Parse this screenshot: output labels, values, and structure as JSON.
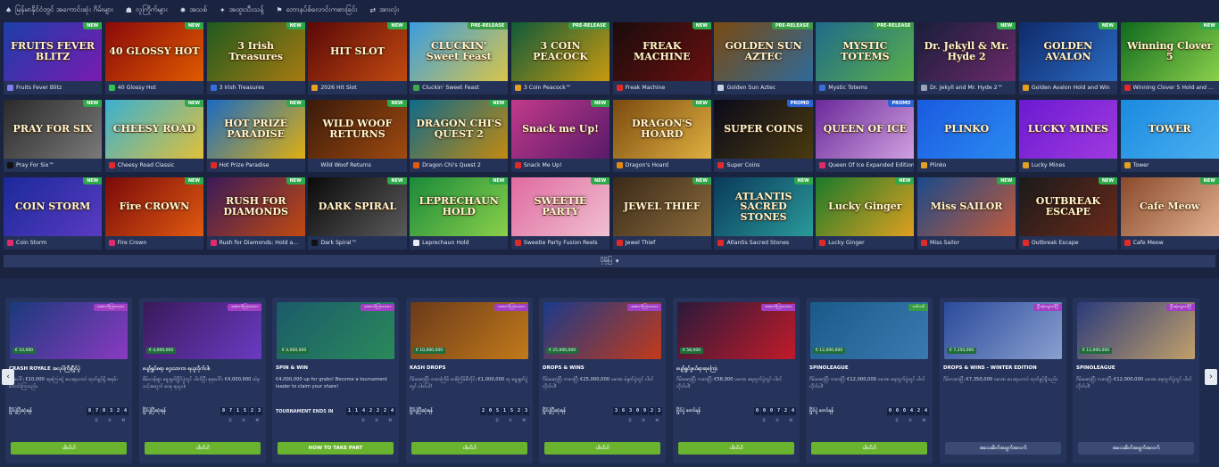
{
  "topnav": [
    {
      "icon": "casino-icon",
      "glyph": "♠",
      "label": "မြန်မာနိုင်ငံတွင် အကောင်းဆုံး ဂိမ်းများ"
    },
    {
      "icon": "lobby-icon",
      "glyph": "☗",
      "label": "လူကြိုက်များ"
    },
    {
      "icon": "new-icon",
      "glyph": "✹",
      "label": "အသစ်"
    },
    {
      "icon": "jackpot-icon",
      "glyph": "✦",
      "label": "အထူးသီးသန့်"
    },
    {
      "icon": "live-icon",
      "glyph": "⚑",
      "label": "ဘောနပ်စ်လောင်းကစားခြင်း"
    },
    {
      "icon": "all-icon",
      "glyph": "⇄",
      "label": "အားလုံး"
    }
  ],
  "games": [
    {
      "thumb": "FRUITS FEVER BLITZ",
      "name": "Fruits Fever Blitz",
      "badge": "NEW",
      "c1": "#1b3fa8",
      "c2": "#7a1bb0",
      "ic": "#7e7ef0"
    },
    {
      "thumb": "40 GLOSSY HOT",
      "name": "40 Glossy Hot",
      "badge": "NEW",
      "c1": "#8a0a0a",
      "c2": "#e05a00",
      "ic": "#33c24f"
    },
    {
      "thumb": "3 Irish Treasures",
      "name": "3 Irish Treasures",
      "badge": "NEW",
      "c1": "#1f5a1f",
      "c2": "#a77a10",
      "ic": "#3a6fd8"
    },
    {
      "thumb": "HIT SLOT",
      "name": "2026 Hit Slot",
      "badge": "NEW",
      "c1": "#5a0808",
      "c2": "#c24a10",
      "ic": "#e8a020"
    },
    {
      "thumb": "CLUCKIN' Sweet Feast",
      "name": "Cluckin' Sweet Feast",
      "badge": "PRE-RELEASE",
      "c1": "#3a9de0",
      "c2": "#d8c44a",
      "ic": "#3fa84a"
    },
    {
      "thumb": "3 COIN PEACOCK",
      "name": "3 Coin Peacock™",
      "badge": "PRE-RELEASE",
      "c1": "#0f5a3a",
      "c2": "#c99a10",
      "ic": "#e0a020"
    },
    {
      "thumb": "FREAK MACHINE",
      "name": "Freak Machine",
      "badge": "NEW",
      "c1": "#1a0c0c",
      "c2": "#6a1010",
      "ic": "#e02a2a"
    },
    {
      "thumb": "GOLDEN SUN AZTEC",
      "name": "Golden Sun Aztec",
      "badge": "PRE-RELEASE",
      "c1": "#7a4a10",
      "c2": "#2f6a9a",
      "ic": "#c7cfe0"
    },
    {
      "thumb": "MYSTIC TOTEMS",
      "name": "Mystic Totems",
      "badge": "PRE-RELEASE",
      "c1": "#1f6a8a",
      "c2": "#5ab04a",
      "ic": "#3a6fd8"
    },
    {
      "thumb": "Dr. Jekyll & Mr. Hyde 2",
      "name": "Dr. Jekyll and Mr. Hyde 2™",
      "badge": "NEW",
      "c1": "#1a1e3a",
      "c2": "#6a2a6a",
      "ic": "#9aa3b8"
    },
    {
      "thumb": "GOLDEN AVALON",
      "name": "Golden Avalon Hold and Win",
      "badge": "NEW",
      "c1": "#0f2a6a",
      "c2": "#2a6ac2",
      "ic": "#e0a020"
    },
    {
      "thumb": "Winning Clover 5",
      "name": "Winning Clover 5 Hold and ...",
      "badge": "NEW",
      "c1": "#0f6a1f",
      "c2": "#8ad04a",
      "ic": "#e02a2a"
    },
    {
      "thumb": "PRAY FOR SIX",
      "name": "Pray For Six™",
      "badge": "NEW",
      "c1": "#2a2a2a",
      "c2": "#7a7a7a",
      "ic": "#111111"
    },
    {
      "thumb": "CHEESY ROAD",
      "name": "Cheesy Road Classic",
      "badge": "NEW",
      "c1": "#3ab0d0",
      "c2": "#e0c03a",
      "ic": "#e02a2a"
    },
    {
      "thumb": "HOT PRIZE PARADISE",
      "name": "Hot Prize Paradise",
      "badge": "NEW",
      "c1": "#1a6ac2",
      "c2": "#e0b010",
      "ic": "#e02a2a"
    },
    {
      "thumb": "WILD WOOF RETURNS",
      "name": "Wild Woof Returns",
      "badge": "NEW",
      "c1": "#3a1a0a",
      "c2": "#a04a10",
      "ic": "#243257"
    },
    {
      "thumb": "DRAGON CHI'S QUEST 2",
      "name": "Dragon Chi's Quest 2",
      "badge": "NEW",
      "c1": "#0f6a8a",
      "c2": "#c28a10",
      "ic": "#e05a10"
    },
    {
      "thumb": "Snack me Up!",
      "name": "Snack Me Up!",
      "badge": "NEW",
      "c1": "#c23a8a",
      "c2": "#5a1a6a",
      "ic": "#e02a2a"
    },
    {
      "thumb": "DRAGON'S HOARD",
      "name": "Dragon's Hoard",
      "badge": "NEW",
      "c1": "#7a4a10",
      "c2": "#e0b040",
      "ic": "#e08a10"
    },
    {
      "thumb": "SUPER COINS",
      "name": "Super Coins",
      "badge": "PROMO",
      "c1": "#0a0a1a",
      "c2": "#4a3a10",
      "ic": "#e02a2a"
    },
    {
      "thumb": "QUEEN OF ICE",
      "name": "Queen Of Ice Expanded Edition",
      "badge": "PROMO",
      "c1": "#6a2a9a",
      "c2": "#d0a0e0",
      "ic": "#e02a6a"
    },
    {
      "thumb": "PLINKO",
      "name": "Plinko",
      "badge": "",
      "c1": "#1a5ae0",
      "c2": "#2a8af0",
      "ic": "#e0a020"
    },
    {
      "thumb": "LUCKY MINES",
      "name": "Lucky Mines",
      "badge": "",
      "c1": "#6a1ad0",
      "c2": "#a03ae0",
      "ic": "#e0a020"
    },
    {
      "thumb": "TOWER",
      "name": "Tower",
      "badge": "",
      "c1": "#1a8ae0",
      "c2": "#4ab0f0",
      "ic": "#e0a020"
    },
    {
      "thumb": "COIN STORM",
      "name": "Coin Storm",
      "badge": "NEW",
      "c1": "#1a2a9a",
      "c2": "#5a3ac2",
      "ic": "#e02a6a"
    },
    {
      "thumb": "Fire CROWN",
      "name": "Fire Crown",
      "badge": "NEW",
      "c1": "#7a0a0a",
      "c2": "#e05a10",
      "ic": "#e02a6a"
    },
    {
      "thumb": "RUSH FOR DIAMONDS",
      "name": "Rush for Diamonds: Hold a...",
      "badge": "NEW",
      "c1": "#3a1a5a",
      "c2": "#c24a10",
      "ic": "#e02a6a"
    },
    {
      "thumb": "DARK SPIRAL",
      "name": "Dark Spiral™",
      "badge": "NEW",
      "c1": "#0a0a0a",
      "c2": "#5a5a5a",
      "ic": "#111111"
    },
    {
      "thumb": "LEPRECHAUN HOLD",
      "name": "Leprechaun Hold",
      "badge": "NEW",
      "c1": "#1a8a3a",
      "c2": "#8ad04a",
      "ic": "#e6ebf5"
    },
    {
      "thumb": "SWEETIE PARTY",
      "name": "Sweetie Party Fusion Reels",
      "badge": "NEW",
      "c1": "#e06aa0",
      "c2": "#f0c0d0",
      "ic": "#e02a2a"
    },
    {
      "thumb": "JEWEL THIEF",
      "name": "Jewel Thief",
      "badge": "NEW",
      "c1": "#3a2a1a",
      "c2": "#8a6a3a",
      "ic": "#e02a2a"
    },
    {
      "thumb": "ATLANTIS SACRED STONES",
      "name": "Atlantis Sacred Stones",
      "badge": "NEW",
      "c1": "#0a3a5a",
      "c2": "#2a9a9a",
      "ic": "#e02a2a"
    },
    {
      "thumb": "Lucky Ginger",
      "name": "Lucky Ginger",
      "badge": "NEW",
      "c1": "#1a7a2a",
      "c2": "#e0a020",
      "ic": "#e02a2a"
    },
    {
      "thumb": "Miss SAILOR",
      "name": "Miss Sailor",
      "badge": "NEW",
      "c1": "#1a4a8a",
      "c2": "#c25a3a",
      "ic": "#e02a2a"
    },
    {
      "thumb": "OUTBREAK ESCAPE",
      "name": "Outbreak Escape",
      "badge": "NEW",
      "c1": "#1a1a1a",
      "c2": "#6a2a1a",
      "ic": "#e02a2a"
    },
    {
      "thumb": "Cafe Meow",
      "name": "Cafe Meow",
      "badge": "NEW",
      "c1": "#8a4a2a",
      "c2": "#e0b090",
      "ic": "#e02a2a"
    }
  ],
  "more_bar": {
    "label": "ပိုမိုပြ",
    "glyph": "▾"
  },
  "promos": [
    {
      "tag": "ထောက်ကြာသေား",
      "tagc": "purple",
      "prize": "€ 10,000",
      "title": "CRASH ROYALE အလုပ်ကြီးပြိုင်ပွဲ",
      "desc": "စုစုပေါင်း €10,000 ဆုကြေးတွဲ ပေးဆုယာလဲ ထုတ်ခွင့်ရှိ အရမ်းကောင်းကြသည်။",
      "timer_label": "ပြိုင်ပွဲပြီးဆုံးရန်",
      "digits": [
        "8",
        "7",
        "0",
        "3",
        "2",
        "4"
      ],
      "cta": "ပါဝင်ပါ",
      "ctac": "green",
      "c1": "#1a3a7a",
      "c2": "#8a3ac2"
    },
    {
      "tag": "ထောက်ကြာသေား",
      "tagc": "purple",
      "prize": "€ 4,000,000",
      "title": "ပျော်ရွှင်စရာ ဂွေးသာကာ ရယူလိုက်ပါ။",
      "desc": "စိမ်းလန်းစွာ ရွေးနှုတ်ပြိုင်ပွဲတွင် ပါဝင်ပြီး စုစုပေါင်း €4,000,000 ထဲမှ သင့်အတွက် ဝေစု ရယူပါ။",
      "timer_label": "ပြိုင်ပွဲပြီးဆုံးရန်",
      "digits": [
        "8",
        "7",
        "1",
        "5",
        "2",
        "3"
      ],
      "cta": "ပါဝင်ပါ",
      "ctac": "green",
      "c1": "#3a1a5a",
      "c2": "#6a3ac2"
    },
    {
      "tag": "ထောက်ကြာသေား",
      "tagc": "purple",
      "prize": "€ 4,000,000",
      "title": "SPIN & WIN",
      "desc": "€4,000,000 up for grabs! Become a tournament leader to claim your share!",
      "timer_label": "TOURNAMENT ENDS IN",
      "digits": [
        "1",
        "1",
        "4",
        "2",
        "2",
        "2",
        "4"
      ],
      "cta": "HOW TO TAKE PART",
      "ctac": "green",
      "c1": "#1a5a6a",
      "c2": "#2a8a5a"
    },
    {
      "tag": "ထောက်ကြာသေား",
      "tagc": "purple",
      "prize": "€ 10,000,000",
      "title": "KASH DROPS",
      "desc": "ဂိမ်းဆော့ပြီး ကစားကြိမ် တစ်ကြိမ်စီတိုင်း €1,000,000 ထု ရွေးနှုတ်ပွဲတွင် ပါဝင်ပါ!",
      "timer_label": "ပြိုင်ပွဲပြီးဆုံးရန်",
      "digits": [
        "2",
        "0",
        "5",
        "1",
        "5",
        "2",
        "3"
      ],
      "cta": "ပါဝင်ပါ",
      "ctac": "green",
      "c1": "#6a3a1a",
      "c2": "#c27a1a"
    },
    {
      "tag": "ထောက်ကြာသေား",
      "tagc": "purple",
      "prize": "€ 25,000,000",
      "title": "DROPS & WINS",
      "desc": "ဂိမ်းဆော့ပြီး ကစားပြီး €25,000,000 ပမာဏ မဲနှုတ်ပွဲတွင် ပါဝင်လိုက်ပါ!",
      "timer_label": "ပြိုင်ပွဲပြီးဆုံးရန်",
      "digits": [
        "3",
        "6",
        "3",
        "0",
        "9",
        "2",
        "3"
      ],
      "cta": "ပါဝင်ပါ",
      "ctac": "green",
      "c1": "#1a3a8a",
      "c2": "#c23a1a"
    },
    {
      "tag": "ထောက်ကြာသေား",
      "tagc": "purple",
      "prize": "€ 58,000",
      "title": "ပျော်ရွှင်ဖွယ်ရာဆုကြေး",
      "desc": "ဂိမ်းဆော့ပြီး ကစားပြီး €58,000 ပမာဏ ရေတွက်ပွဲတွင် ပါဝင်လိုက်ပါ!",
      "timer_label": "ပြိုင်ပွဲ စတင်ရန်",
      "digits": [
        "0",
        "0",
        "0",
        "7",
        "2",
        "4"
      ],
      "cta": "ပါဝင်ပါ",
      "ctac": "green",
      "c1": "#2a1a3a",
      "c2": "#c21a2a"
    },
    {
      "tag": "သစ်သစ်",
      "tagc": "green",
      "prize": "€ 12,000,000",
      "title": "SPINOLEAGUE",
      "desc": "ဂိမ်းဆော့ပြီး ကစားပြီး €12,000,000 ပမာဏ ရေတွက်ပွဲတွင် ပါဝင်လိုက်ပါ!",
      "timer_label": "ပြိုင်ပွဲ စတင်ရန်",
      "digits": [
        "0",
        "0",
        "0",
        "4",
        "2",
        "4"
      ],
      "cta": "ပါဝင်ပါ",
      "ctac": "green",
      "c1": "#1a5a8a",
      "c2": "#3a7ab0"
    },
    {
      "tag": "ပြီးဆုံးသွားပါပြီ",
      "tagc": "purple",
      "prize": "€ 7,250,000",
      "title": "DROPS & WINS - WINTER EDITION",
      "desc": "ဂိမ်းကစားပြီး €7,350,000 ပမာဏ ပေးဆုယာလဲ ထုတ်ခွင့်ရှိသည်။",
      "timer_label": "",
      "digits": [],
      "cta": "အသေးစိတ်အချက်အလက်",
      "ctac": "dark",
      "c1": "#2a4a9a",
      "c2": "#8aa0d0"
    },
    {
      "tag": "ပြီးဆုံးသွားပါပြီ",
      "tagc": "purple",
      "prize": "€ 12,000,000",
      "title": "SPINOLEAGUE",
      "desc": "ဂိမ်းဆော့ပြီး ကစားပြီး €12,000,000 ပမာဏ ရေတွက်ပွဲတွင် ပါဝင်လိုက်ပါ!",
      "timer_label": "",
      "digits": [],
      "cta": "အသေးစိတ်အချက်အလက်",
      "ctac": "dark",
      "c1": "#2a3a7a",
      "c2": "#c2a06a"
    }
  ],
  "dhm": [
    "D",
    "H",
    "M"
  ],
  "arrows": {
    "left": "‹",
    "right": "›"
  }
}
